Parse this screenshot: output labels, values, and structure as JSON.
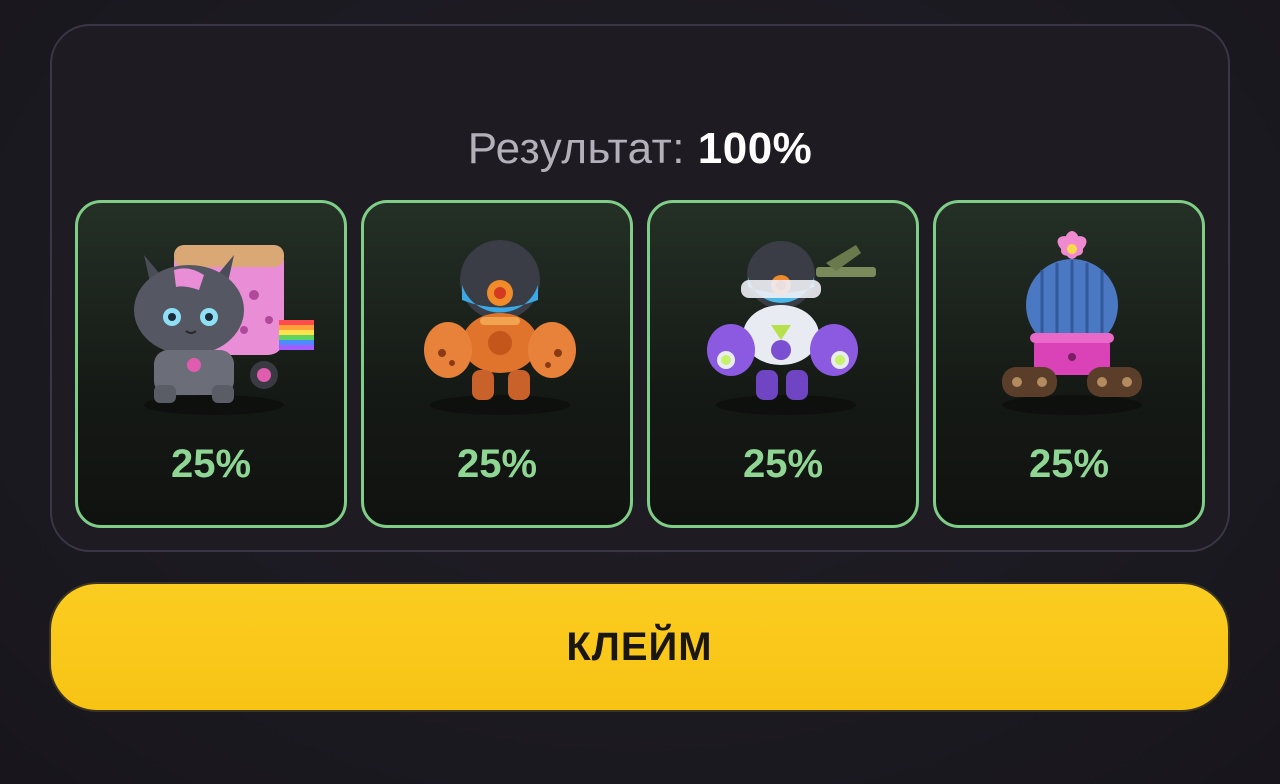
{
  "result": {
    "label": "Результат:",
    "value": "100%"
  },
  "cards": [
    {
      "name": "robot-cat",
      "percent": "25%",
      "icon": "robot-cat-icon"
    },
    {
      "name": "orange-mech",
      "percent": "25%",
      "icon": "orange-mech-icon"
    },
    {
      "name": "purple-mech",
      "percent": "25%",
      "icon": "purple-mech-icon"
    },
    {
      "name": "cactus-tank",
      "percent": "25%",
      "icon": "cactus-tank-icon"
    }
  ],
  "claim_button": {
    "label": "КЛЕЙМ"
  },
  "colors": {
    "card_border": "#7fcd86",
    "percent_text": "#8fd694",
    "button_bg": "#f9c71a",
    "panel_border": "#3a3645"
  }
}
